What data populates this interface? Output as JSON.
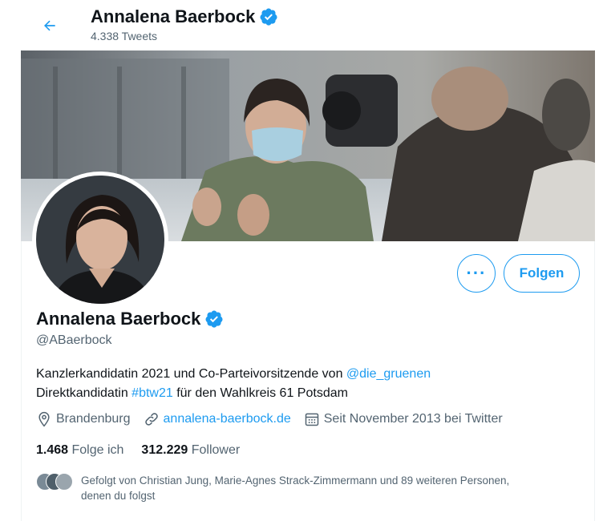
{
  "header": {
    "name": "Annalena Baerbock",
    "tweet_count": "4.338 Tweets"
  },
  "profile": {
    "display_name": "Annalena Baerbock",
    "handle": "@ABaerbock",
    "bio_line1_prefix": "Kanzlerkandidatin 2021 und Co-Parteivorsitzende von ",
    "bio_mention": "@die_gruenen",
    "bio_line2_prefix": "Direktkandidatin ",
    "bio_hashtag": "#btw21",
    "bio_line2_suffix": " für den Wahlkreis 61 Potsdam",
    "location": "Brandenburg",
    "website": "annalena-baerbock.de",
    "joined": "Seit November 2013 bei Twitter"
  },
  "stats": {
    "following_count": "1.468",
    "following_label": "Folge ich",
    "followers_count": "312.229",
    "followers_label": "Follower"
  },
  "followed_by": {
    "line1": "Gefolgt von Christian Jung, Marie-Agnes Strack-Zimmermann und 89 weiteren Personen,",
    "line2": "denen du folgst"
  },
  "actions": {
    "more_label": "···",
    "follow_label": "Folgen"
  },
  "colors": {
    "accent": "#1d9bf0",
    "text": "#0f1419",
    "secondary": "#536471"
  },
  "icons": [
    "back-arrow-icon",
    "verified-badge-icon",
    "location-pin-icon",
    "link-icon",
    "calendar-icon"
  ]
}
